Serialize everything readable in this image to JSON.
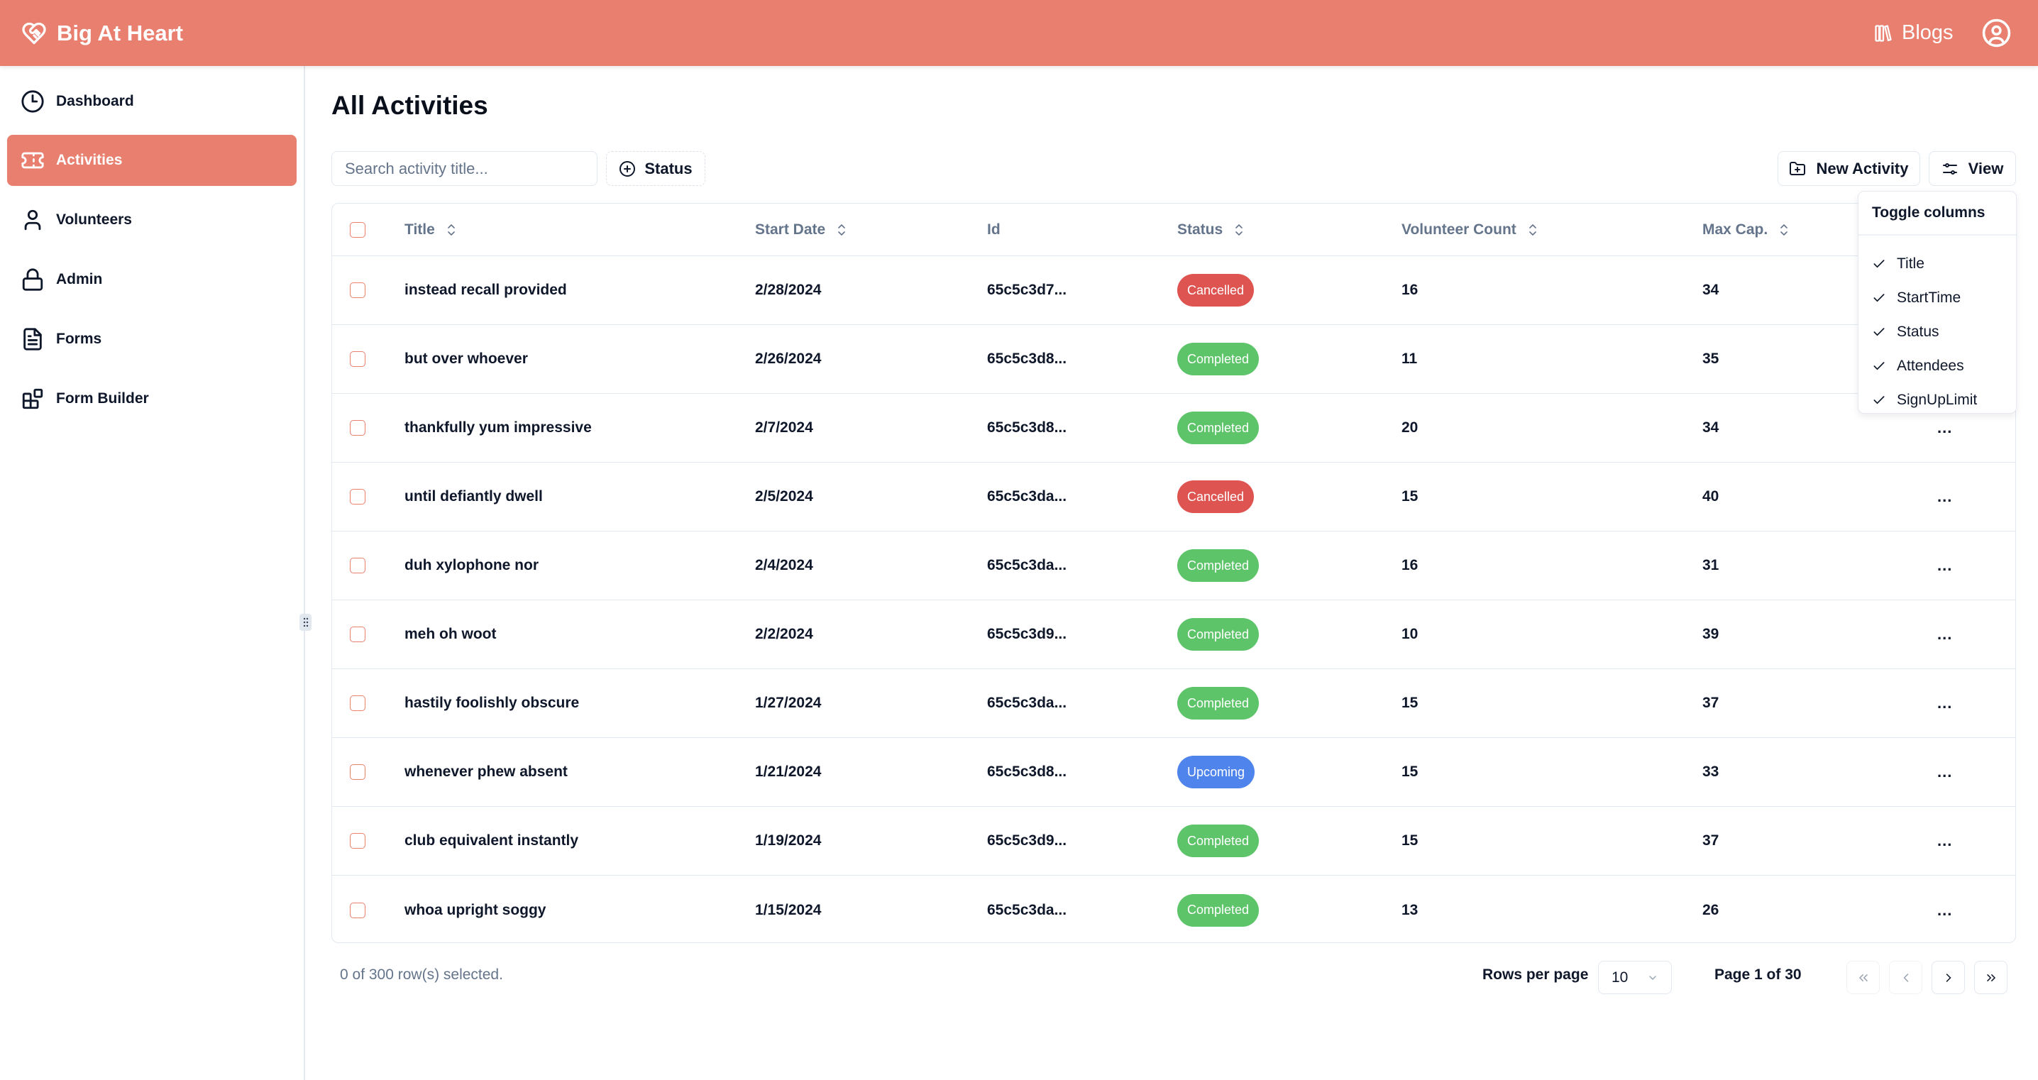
{
  "app": {
    "brand": "Big At Heart",
    "blogs_label": "Blogs",
    "accent_color": "#e97f6f"
  },
  "sidebar": {
    "items": [
      {
        "label": "Dashboard",
        "icon": "clock-icon",
        "active": false
      },
      {
        "label": "Activities",
        "icon": "ticket-icon",
        "active": true
      },
      {
        "label": "Volunteers",
        "icon": "user-icon",
        "active": false
      },
      {
        "label": "Admin",
        "icon": "lock-icon",
        "active": false
      },
      {
        "label": "Forms",
        "icon": "file-text-icon",
        "active": false
      },
      {
        "label": "Form Builder",
        "icon": "blocks-icon",
        "active": false
      }
    ]
  },
  "main": {
    "title": "All Activities",
    "search_placeholder": "Search activity title...",
    "search_value": "",
    "status_filter_label": "Status",
    "new_activity_label": "New Activity",
    "view_label": "View"
  },
  "table": {
    "columns": [
      "Title",
      "Start Date",
      "Id",
      "Status",
      "Volunteer Count",
      "Max Cap."
    ],
    "rows": [
      {
        "title": "instead recall provided",
        "start_date": "2/28/2024",
        "id": "65c5c3d7...",
        "status": "Cancelled",
        "volunteer_count": "16",
        "max_cap": "34"
      },
      {
        "title": "but over whoever",
        "start_date": "2/26/2024",
        "id": "65c5c3d8...",
        "status": "Completed",
        "volunteer_count": "11",
        "max_cap": "35"
      },
      {
        "title": "thankfully yum impressive",
        "start_date": "2/7/2024",
        "id": "65c5c3d8...",
        "status": "Completed",
        "volunteer_count": "20",
        "max_cap": "34"
      },
      {
        "title": "until defiantly dwell",
        "start_date": "2/5/2024",
        "id": "65c5c3da...",
        "status": "Cancelled",
        "volunteer_count": "15",
        "max_cap": "40"
      },
      {
        "title": "duh xylophone nor",
        "start_date": "2/4/2024",
        "id": "65c5c3da...",
        "status": "Completed",
        "volunteer_count": "16",
        "max_cap": "31"
      },
      {
        "title": "meh oh woot",
        "start_date": "2/2/2024",
        "id": "65c5c3d9...",
        "status": "Completed",
        "volunteer_count": "10",
        "max_cap": "39"
      },
      {
        "title": "hastily foolishly obscure",
        "start_date": "1/27/2024",
        "id": "65c5c3da...",
        "status": "Completed",
        "volunteer_count": "15",
        "max_cap": "37"
      },
      {
        "title": "whenever phew absent",
        "start_date": "1/21/2024",
        "id": "65c5c3d8...",
        "status": "Upcoming",
        "volunteer_count": "15",
        "max_cap": "33"
      },
      {
        "title": "club equivalent instantly",
        "start_date": "1/19/2024",
        "id": "65c5c3d9...",
        "status": "Completed",
        "volunteer_count": "15",
        "max_cap": "37"
      },
      {
        "title": "whoa upright soggy",
        "start_date": "1/15/2024",
        "id": "65c5c3da...",
        "status": "Completed",
        "volunteer_count": "13",
        "max_cap": "26"
      }
    ],
    "actions_label": "...",
    "status_colors": {
      "Cancelled": "#de5450",
      "Completed": "#5ec46a",
      "Upcoming": "#4f84ed"
    }
  },
  "toggle_columns": {
    "title": "Toggle columns",
    "items": [
      {
        "label": "Title",
        "checked": true
      },
      {
        "label": "StartTime",
        "checked": true
      },
      {
        "label": "Status",
        "checked": true
      },
      {
        "label": "Attendees",
        "checked": true
      },
      {
        "label": "SignUpLimit",
        "checked": true
      }
    ]
  },
  "footer": {
    "selection_text": "0 of 300 row(s) selected.",
    "rows_per_page_label": "Rows per page",
    "rows_per_page_value": "10",
    "page_info": "Page 1 of 30"
  }
}
